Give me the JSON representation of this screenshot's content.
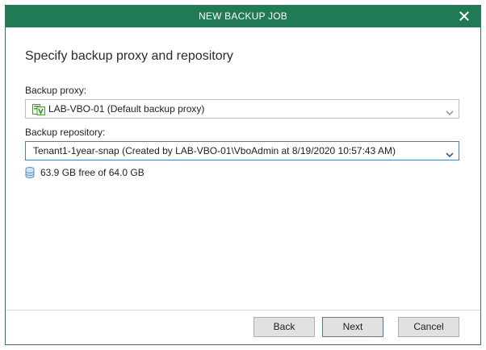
{
  "window": {
    "title": "NEW BACKUP JOB",
    "heading": "Specify backup proxy and repository"
  },
  "proxy": {
    "label": "Backup proxy:",
    "value": "LAB-VBO-01 (Default backup proxy)",
    "icon": "server-proxy-icon"
  },
  "repository": {
    "label": "Backup repository:",
    "value": "Tenant1-1year-snap (Created by LAB-VBO-01\\VboAdmin at 8/19/2020 10:57:43 AM)",
    "capacity": "63.9 GB free of 64.0 GB",
    "icon": "database-icon"
  },
  "buttons": {
    "back": "Back",
    "next": "Next",
    "cancel": "Cancel"
  },
  "colors": {
    "titlebar": "#1f7a55",
    "accent": "#4a7fb5"
  }
}
